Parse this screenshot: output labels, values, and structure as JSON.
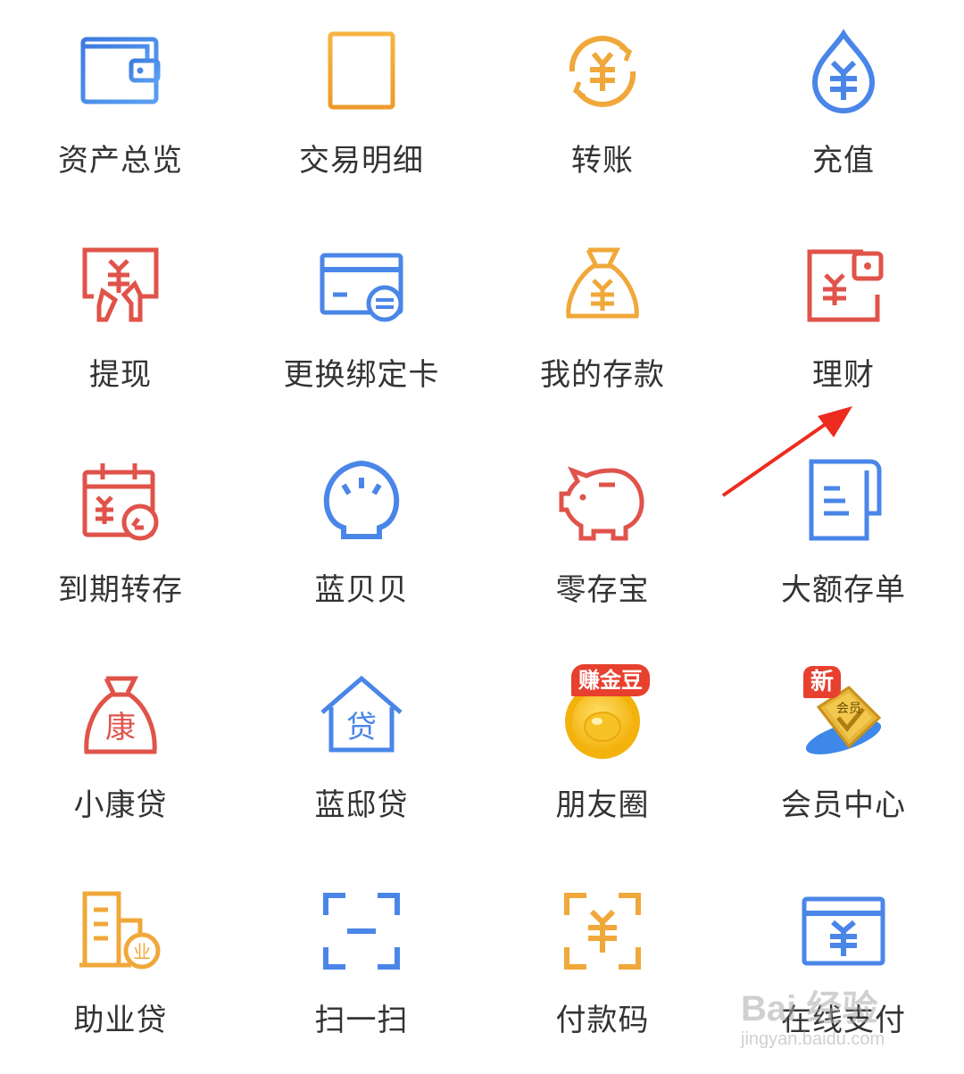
{
  "colors": {
    "blue": "#4a86e8",
    "orange": "#f0a83a",
    "red": "#e0534a",
    "arrow": "#ee2b20",
    "text": "#333333"
  },
  "menu": [
    {
      "label": "资产总览",
      "icon": "wallet-icon"
    },
    {
      "label": "交易明细",
      "icon": "document-icon"
    },
    {
      "label": "转账",
      "icon": "yuan-transfer-icon"
    },
    {
      "label": "充值",
      "icon": "yuan-drop-icon"
    },
    {
      "label": "提现",
      "icon": "yuan-withdraw-icon"
    },
    {
      "label": "更换绑定卡",
      "icon": "card-swap-icon"
    },
    {
      "label": "我的存款",
      "icon": "money-bag-icon"
    },
    {
      "label": "理财",
      "icon": "yuan-wallet-icon"
    },
    {
      "label": "到期转存",
      "icon": "calendar-renew-icon"
    },
    {
      "label": "蓝贝贝",
      "icon": "shell-icon"
    },
    {
      "label": "零存宝",
      "icon": "piggy-bank-icon"
    },
    {
      "label": "大额存单",
      "icon": "certificate-icon"
    },
    {
      "label": "小康贷",
      "icon": "kang-bag-icon",
      "icon_text": "康"
    },
    {
      "label": "蓝邸贷",
      "icon": "house-loan-icon",
      "icon_text": "贷"
    },
    {
      "label": "朋友圈",
      "icon": "gold-bean-icon",
      "badge": "赚金豆"
    },
    {
      "label": "会员中心",
      "icon": "member-card-icon",
      "badge": "新",
      "icon_text": "会员"
    },
    {
      "label": "助业贷",
      "icon": "business-loan-icon",
      "icon_text": "业"
    },
    {
      "label": "扫一扫",
      "icon": "scan-icon"
    },
    {
      "label": "付款码",
      "icon": "pay-code-icon"
    },
    {
      "label": "在线支付",
      "icon": "online-pay-icon"
    }
  ],
  "watermark": {
    "main": "Bai 经验",
    "sub": "jingyan.baidu.com"
  }
}
